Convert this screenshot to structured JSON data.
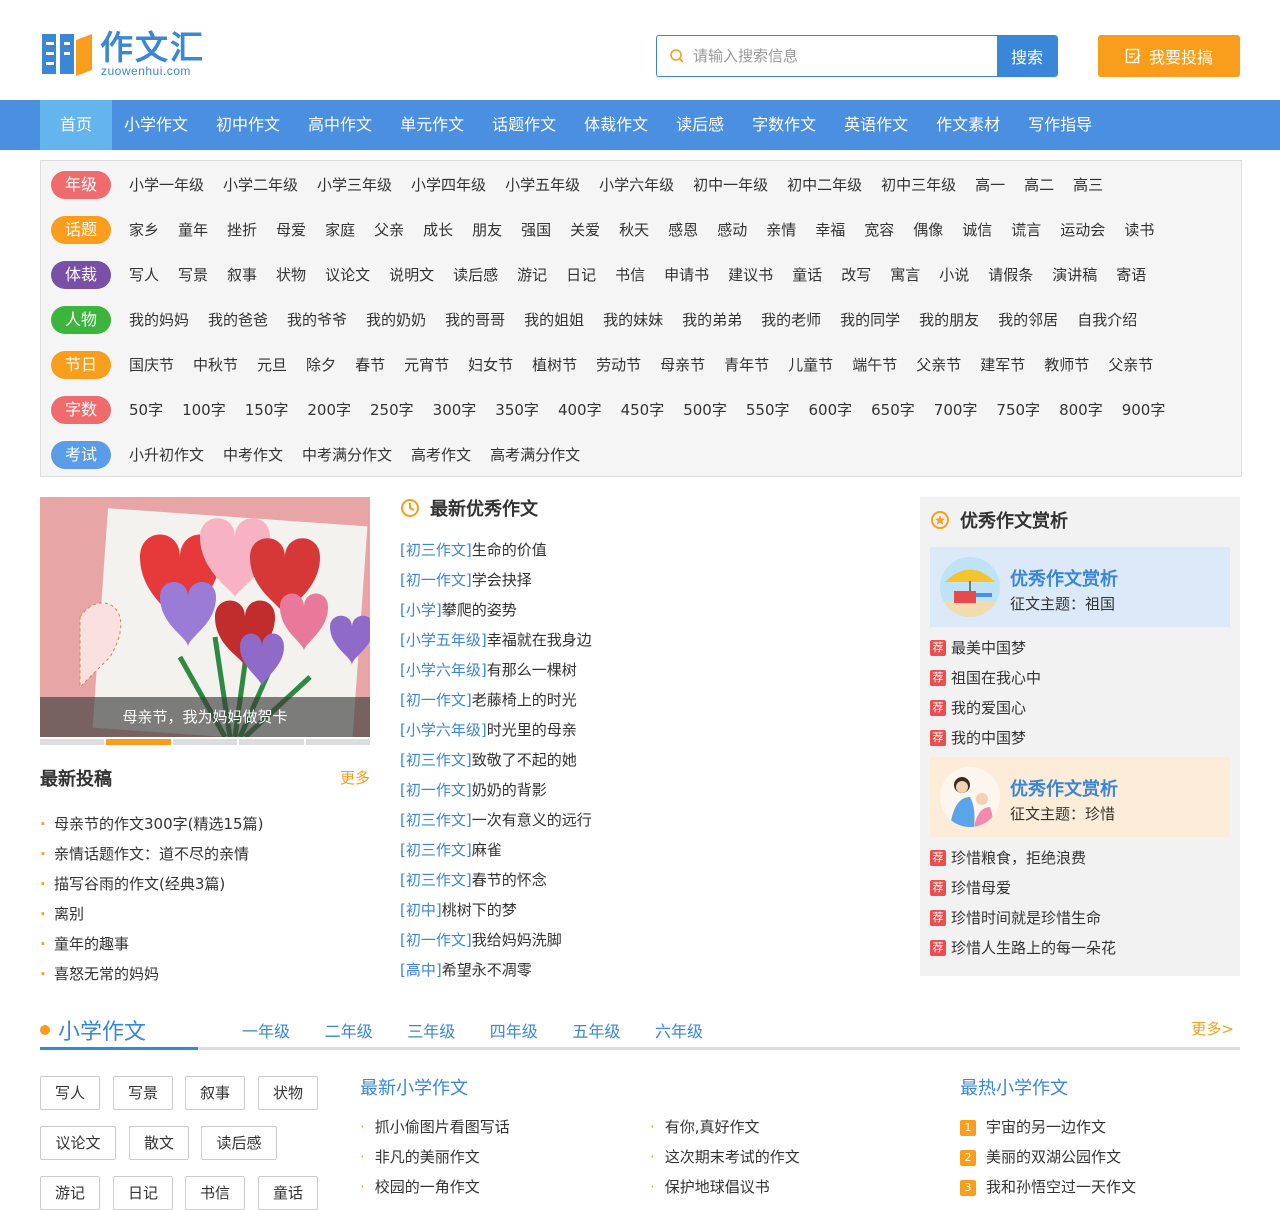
{
  "header": {
    "logo_text": "作文汇",
    "logo_sub": "zuowenhui.com",
    "search_placeholder": "请输入搜索信息",
    "search_button": "搜索",
    "submit_button": "我要投搞"
  },
  "nav": [
    "首页",
    "小学作文",
    "初中作文",
    "高中作文",
    "单元作文",
    "话题作文",
    "体裁作文",
    "读后感",
    "字数作文",
    "英语作文",
    "作文素材",
    "写作指导"
  ],
  "categories": [
    {
      "tag": "年级",
      "color": "#f06b6d",
      "items": [
        "小学一年级",
        "小学二年级",
        "小学三年级",
        "小学四年级",
        "小学五年级",
        "小学六年级",
        "初中一年级",
        "初中二年级",
        "初中三年级",
        "高一",
        "高二",
        "高三"
      ]
    },
    {
      "tag": "话题",
      "color": "#f99e1c",
      "items": [
        "家乡",
        "童年",
        "挫折",
        "母爱",
        "家庭",
        "父亲",
        "成长",
        "朋友",
        "强国",
        "关爱",
        "秋天",
        "感恩",
        "感动",
        "亲情",
        "幸福",
        "宽容",
        "偶像",
        "诚信",
        "谎言",
        "运动会",
        "读书"
      ]
    },
    {
      "tag": "体裁",
      "color": "#7a4fa8",
      "items": [
        "写人",
        "写景",
        "叙事",
        "状物",
        "议论文",
        "说明文",
        "读后感",
        "游记",
        "日记",
        "书信",
        "申请书",
        "建议书",
        "童话",
        "改写",
        "寓言",
        "小说",
        "请假条",
        "演讲稿",
        "寄语"
      ]
    },
    {
      "tag": "人物",
      "color": "#3cb53c",
      "items": [
        "我的妈妈",
        "我的爸爸",
        "我的爷爷",
        "我的奶奶",
        "我的哥哥",
        "我的姐姐",
        "我的妹妹",
        "我的弟弟",
        "我的老师",
        "我的同学",
        "我的朋友",
        "我的邻居",
        "自我介绍"
      ]
    },
    {
      "tag": "节日",
      "color": "#f99e1c",
      "items": [
        "国庆节",
        "中秋节",
        "元旦",
        "除夕",
        "春节",
        "元宵节",
        "妇女节",
        "植树节",
        "劳动节",
        "母亲节",
        "青年节",
        "儿童节",
        "端午节",
        "父亲节",
        "建军节",
        "教师节",
        "父亲节"
      ]
    },
    {
      "tag": "字数",
      "color": "#f06b6d",
      "items": [
        "50字",
        "100字",
        "150字",
        "200字",
        "250字",
        "300字",
        "350字",
        "400字",
        "450字",
        "500字",
        "550字",
        "600字",
        "650字",
        "700字",
        "750字",
        "800字",
        "900字"
      ]
    },
    {
      "tag": "考试",
      "color": "#5a9de6",
      "items": [
        "小升初作文",
        "中考作文",
        "中考满分作文",
        "高考作文",
        "高考满分作文"
      ]
    }
  ],
  "slider": {
    "caption": "母亲节，我为妈妈做贺卡"
  },
  "latest_submissions": {
    "title": "最新投稿",
    "more": "更多",
    "items": [
      "母亲节的作文300字(精选15篇)",
      "亲情话题作文：道不尽的亲情",
      "描写谷雨的作文(经典3篇)",
      "离别",
      "童年的趣事",
      "喜怒无常的妈妈"
    ]
  },
  "best": {
    "title": "最新优秀作文",
    "items": [
      {
        "cat": "[初三作文]",
        "title": "生命的价值"
      },
      {
        "cat": "[初一作文]",
        "title": "学会抉择"
      },
      {
        "cat": "[小学]",
        "title": "攀爬的姿势"
      },
      {
        "cat": "[小学五年级]",
        "title": "幸福就在我身边"
      },
      {
        "cat": "[小学六年级]",
        "title": "有那么一棵树"
      },
      {
        "cat": "[初一作文]",
        "title": "老藤椅上的时光"
      },
      {
        "cat": "[小学六年级]",
        "title": "时光里的母亲"
      },
      {
        "cat": "[初三作文]",
        "title": "致敬了不起的她"
      },
      {
        "cat": "[初一作文]",
        "title": "奶奶的背影"
      },
      {
        "cat": "[初三作文]",
        "title": "一次有意义的远行"
      },
      {
        "cat": "[初三作文]",
        "title": "麻雀"
      },
      {
        "cat": "[初三作文]",
        "title": "春节的怀念"
      },
      {
        "cat": "[初中]",
        "title": "桃树下的梦"
      },
      {
        "cat": "[初一作文]",
        "title": "我给妈妈洗脚"
      },
      {
        "cat": "[高中]",
        "title": "希望永不凋零"
      }
    ]
  },
  "appreciation": {
    "title": "优秀作文赏析",
    "badge": "荐",
    "cards": [
      {
        "title": "优秀作文赏析",
        "theme": "征文主题：祖国",
        "bg": "#dbe9f9",
        "items": [
          "最美中国梦",
          "祖国在我心中",
          "我的爱国心",
          "我的中国梦"
        ]
      },
      {
        "title": "优秀作文赏析",
        "theme": "征文主题：珍惜",
        "bg": "#fdecd8",
        "items": [
          "珍惜粮食，拒绝浪费",
          "珍惜母爱",
          "珍惜时间就是珍惜生命",
          "珍惜人生路上的每一朵花"
        ]
      }
    ]
  },
  "primary": {
    "title": "小学作文",
    "tabs": [
      "一年级",
      "二年级",
      "三年级",
      "四年级",
      "五年级",
      "六年级"
    ],
    "more": "更多>",
    "tags": [
      "写人",
      "写景",
      "叙事",
      "状物",
      "议论文",
      "散文",
      "读后感",
      "游记",
      "日记",
      "书信",
      "童话"
    ],
    "latest_title": "最新小学作文",
    "latest_left": [
      "抓小偷图片看图写话",
      "非凡的美丽作文",
      "校园的一角作文"
    ],
    "latest_right": [
      "有你,真好作文",
      "这次期末考试的作文",
      "保护地球倡议书"
    ],
    "hot_title": "最热小学作文",
    "hot": [
      "宇宙的另一边作文",
      "美丽的双湖公园作文",
      "我和孙悟空过一天作文"
    ]
  }
}
